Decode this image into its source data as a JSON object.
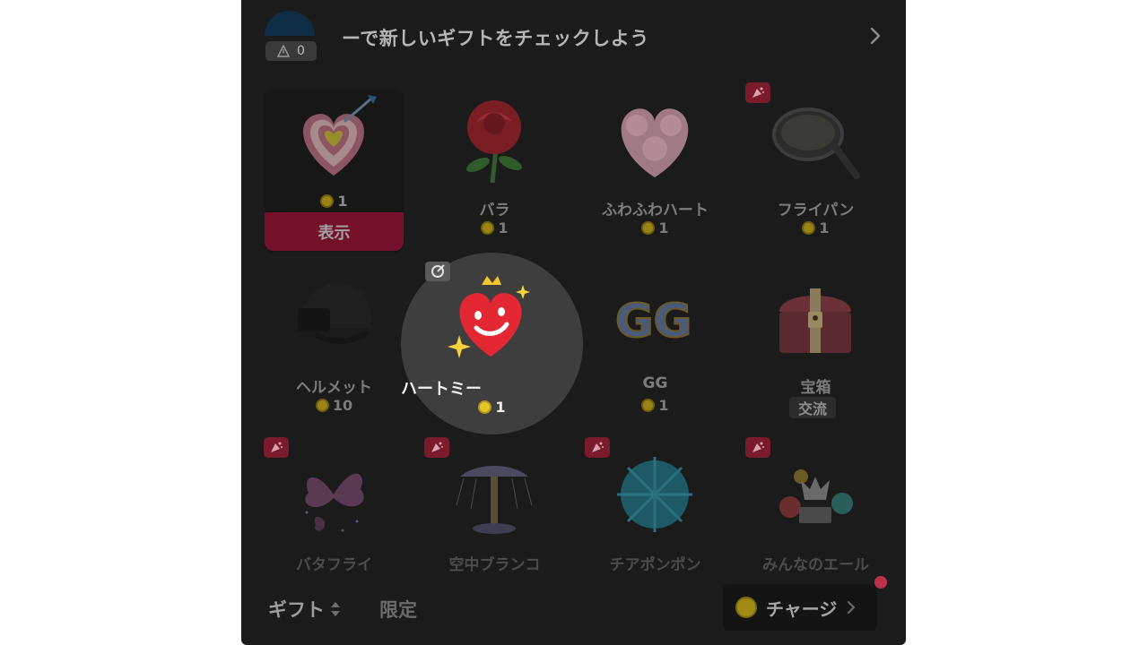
{
  "header": {
    "badge_count": "0",
    "text": "ーで新しいギフトをチェックしよう"
  },
  "gifts": [
    {
      "name": "",
      "price": "1",
      "action": "表示",
      "tag": false
    },
    {
      "name": "バラ",
      "price": "1",
      "tag": false
    },
    {
      "name": "ふわふわハート",
      "price": "1",
      "tag": false
    },
    {
      "name": "フライパン",
      "price": "1",
      "tag": true
    },
    {
      "name": "ヘルメット",
      "price": "10",
      "tag": false
    },
    {
      "name": "ハートミー",
      "price": "1",
      "selected": true
    },
    {
      "name": "GG",
      "price": "1",
      "tag": false
    },
    {
      "name": "宝箱",
      "label": "交流",
      "tag": false
    },
    {
      "name": "バタフライ",
      "tag": true
    },
    {
      "name": "空中ブランコ",
      "tag": true
    },
    {
      "name": "チアポンポン",
      "tag": true
    },
    {
      "name": "みんなのエール",
      "tag": true
    }
  ],
  "footer": {
    "tab_gift": "ギフト",
    "tab_limited": "限定",
    "charge_label": "チャージ"
  },
  "colors": {
    "panel": "#1b1b1b",
    "accent": "#74102a",
    "coin": "#e4c527",
    "notification": "#c0304a"
  },
  "icons": [
    "alert-triangle-icon",
    "chevron-right-icon",
    "sort-arrows-icon",
    "coin-icon",
    "party-popper-icon",
    "combo-icon"
  ]
}
